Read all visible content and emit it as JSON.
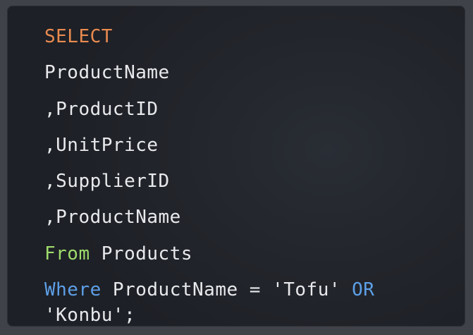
{
  "colors": {
    "select_keyword": "#e98a4f",
    "from_keyword": "#9ddb6b",
    "where_keyword": "#5d9fe8",
    "text": "#e8e9ec",
    "background": "#22252b"
  },
  "code": {
    "select_kw": "SELECT",
    "col1": "ProductName",
    "col2": ",ProductID",
    "col3": ",UnitPrice",
    "col4": ",SupplierID",
    "col5": ",ProductName",
    "from_kw": "From",
    "from_table": " Products",
    "where_kw": "Where",
    "where_condition": " ProductName = 'Tofu' ",
    "or_kw": "OR",
    "where_continuation": "'Konbu';"
  }
}
